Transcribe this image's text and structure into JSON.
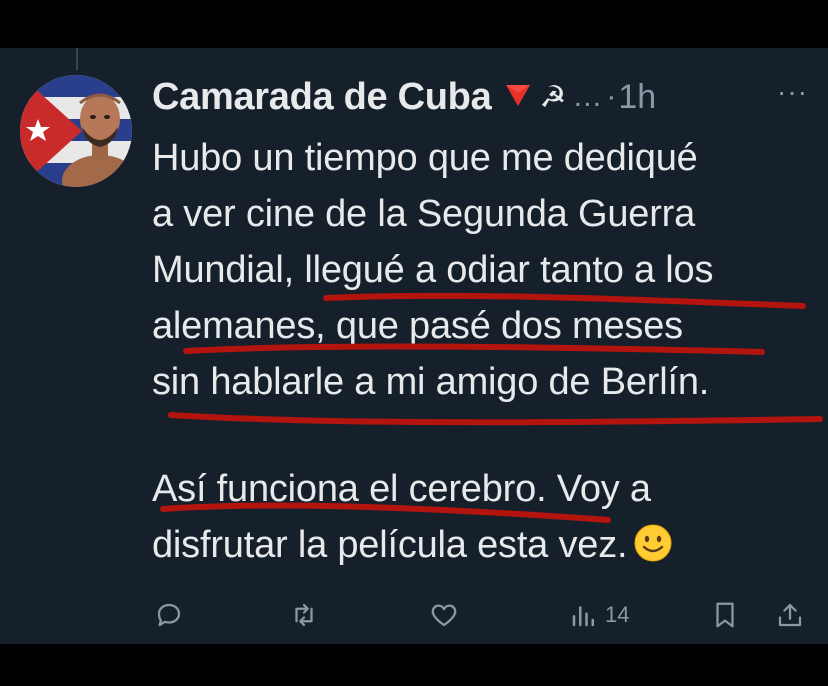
{
  "tweet": {
    "author_name": "Camarada de Cuba",
    "author_emoji_hs": "☭",
    "ellipsis": "…",
    "dot": "·",
    "time": "1h",
    "more_label": "···",
    "lines_p1": [
      "Hubo un tiempo que me dediqué",
      "a ver cine de la Segunda Guerra",
      "Mundial, llegué a odiar tanto a los",
      "alemanes, que pasé dos meses",
      "sin hablarle a mi amigo de Berlín."
    ],
    "lines_p2": [
      "Así funciona el cerebro. Voy a",
      "disfrutar la película esta vez."
    ],
    "actions": {
      "views_count": "14"
    }
  },
  "colors": {
    "background": "#16202b",
    "text": "#e7e9ea",
    "muted": "#8b98a5",
    "annotation_red": "#b3140e"
  },
  "icons": [
    "reply-icon",
    "retweet-icon",
    "like-icon",
    "views-icon",
    "bookmark-icon",
    "share-icon",
    "smile-emoji-icon",
    "red-triangle-icon",
    "hammer-sickle-icon"
  ]
}
